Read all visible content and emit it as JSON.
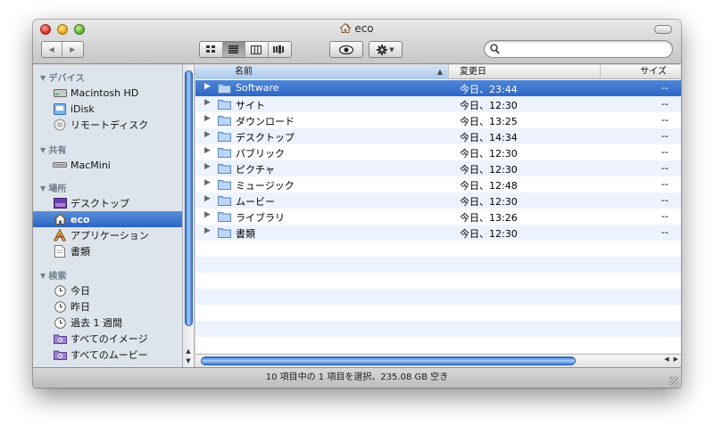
{
  "window": {
    "title": "eco"
  },
  "toolbar": {
    "back_label": "◀",
    "forward_label": "▶"
  },
  "search": {
    "placeholder": "",
    "value": ""
  },
  "sidebar": {
    "sections": [
      {
        "heading": "デバイス",
        "items": [
          {
            "label": "Macintosh HD",
            "icon": "hard-drive-icon"
          },
          {
            "label": "iDisk",
            "icon": "idisk-icon"
          },
          {
            "label": "リモートディスク",
            "icon": "remote-disc-icon"
          }
        ]
      },
      {
        "heading": "共有",
        "items": [
          {
            "label": "MacMini",
            "icon": "network-computer-icon"
          }
        ]
      },
      {
        "heading": "場所",
        "items": [
          {
            "label": "デスクトップ",
            "icon": "desktop-icon"
          },
          {
            "label": "eco",
            "icon": "home-icon",
            "selected": true
          },
          {
            "label": "アプリケーション",
            "icon": "applications-icon"
          },
          {
            "label": "書類",
            "icon": "documents-icon"
          }
        ]
      },
      {
        "heading": "検索",
        "items": [
          {
            "label": "今日",
            "icon": "clock-icon"
          },
          {
            "label": "昨日",
            "icon": "clock-icon"
          },
          {
            "label": "過去 1 週間",
            "icon": "clock-icon"
          },
          {
            "label": "すべてのイメージ",
            "icon": "smart-folder-icon"
          },
          {
            "label": "すべてのムービー",
            "icon": "smart-folder-icon"
          }
        ]
      }
    ]
  },
  "list": {
    "columns": {
      "name": "名前",
      "date": "変更日",
      "size": "サイズ"
    },
    "rows": [
      {
        "name": "Software",
        "date": "今日、23:44",
        "size": "--",
        "selected": true
      },
      {
        "name": "サイト",
        "date": "今日、12:30",
        "size": "--"
      },
      {
        "name": "ダウンロード",
        "date": "今日、13:25",
        "size": "--"
      },
      {
        "name": "デスクトップ",
        "date": "今日、14:34",
        "size": "--"
      },
      {
        "name": "パブリック",
        "date": "今日、12:30",
        "size": "--"
      },
      {
        "name": "ピクチャ",
        "date": "今日、12:30",
        "size": "--"
      },
      {
        "name": "ミュージック",
        "date": "今日、12:48",
        "size": "--"
      },
      {
        "name": "ムービー",
        "date": "今日、12:30",
        "size": "--"
      },
      {
        "name": "ライブラリ",
        "date": "今日、13:26",
        "size": "--"
      },
      {
        "name": "書類",
        "date": "今日、12:30",
        "size": "--"
      }
    ]
  },
  "status": {
    "text": "10 項目中の 1 項目を選択、235.08 GB 空き"
  },
  "colors": {
    "selection": "#3a74d0",
    "sidebar_bg": "#dde4ec",
    "alt_row": "#edf3fe"
  }
}
